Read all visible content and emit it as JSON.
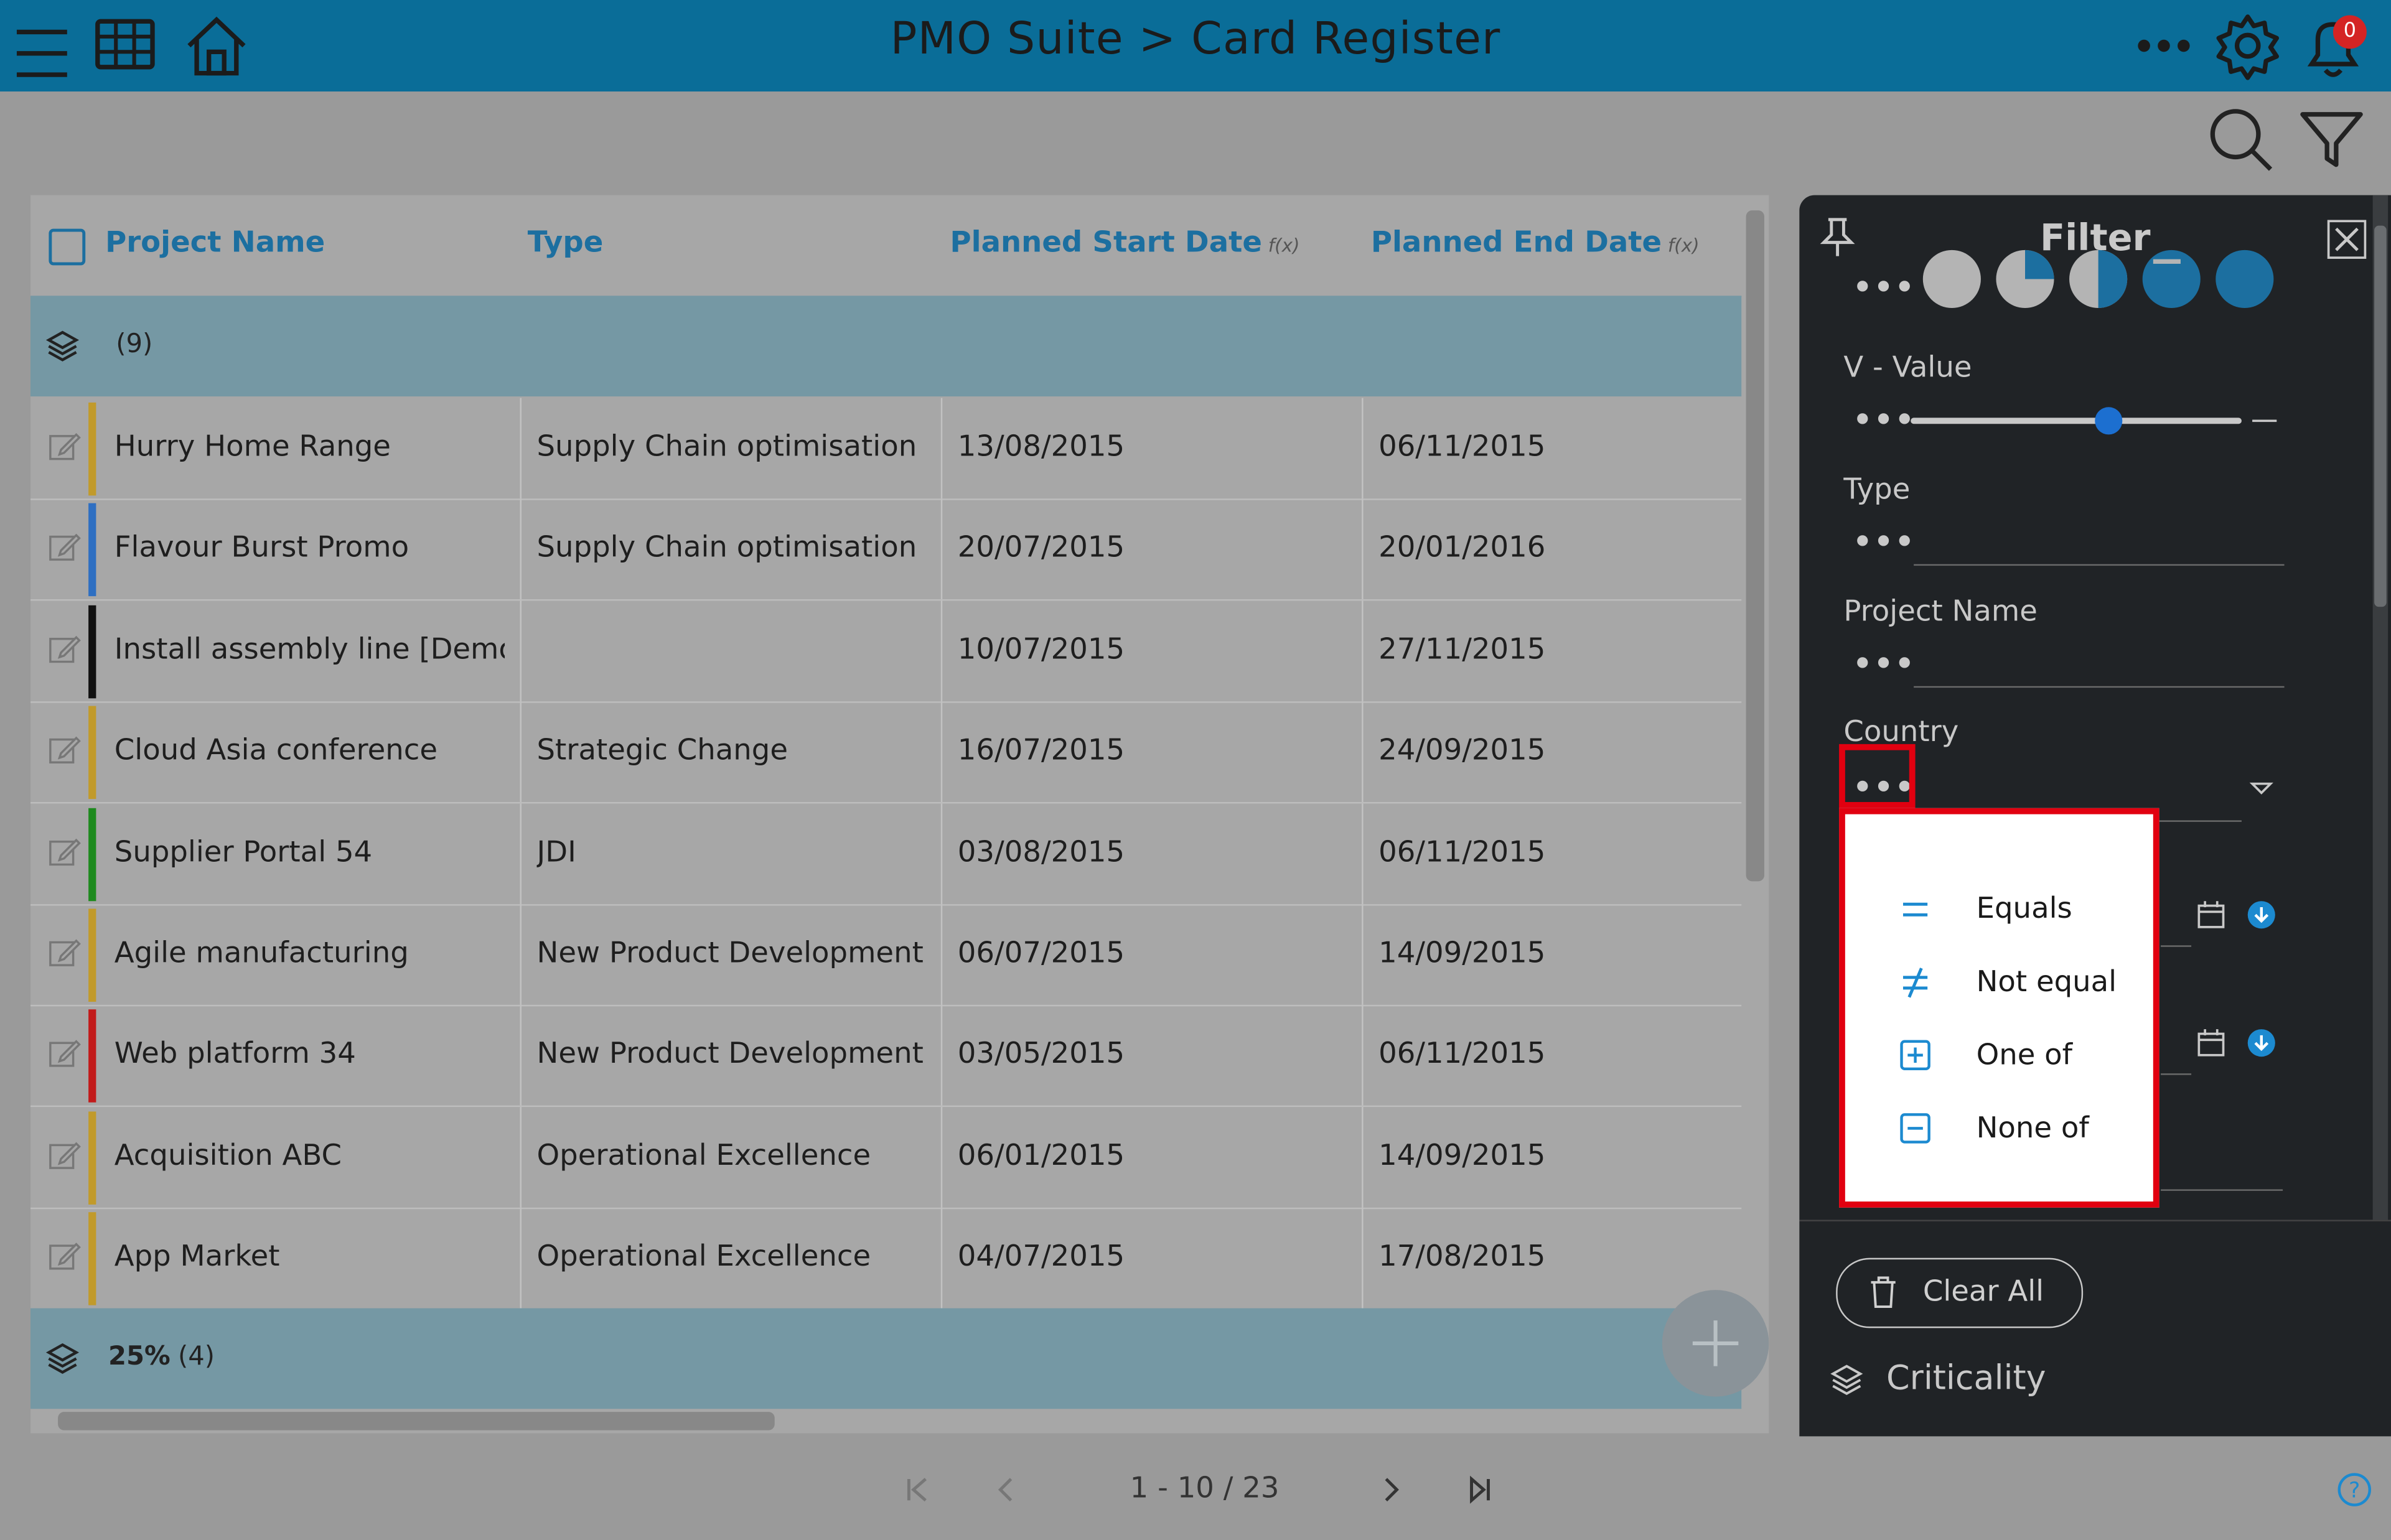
{
  "header": {
    "title": "PMO Suite > Card Register",
    "notification_count": "0"
  },
  "grid": {
    "columns": [
      {
        "label": "Project Name",
        "fx": ""
      },
      {
        "label": "Type",
        "fx": ""
      },
      {
        "label": "Planned Start Date",
        "fx": "f(x)"
      },
      {
        "label": "Planned End Date",
        "fx": "f(x)"
      }
    ],
    "group1": {
      "label": "",
      "count": "(9)"
    },
    "rows": [
      {
        "name": "Hurry Home Range",
        "type": "Supply Chain optimisation",
        "start": "13/08/2015",
        "end": "06/11/2015",
        "color": "#c19a2b"
      },
      {
        "name": "Flavour Burst Promo",
        "type": "Supply Chain optimisation",
        "start": "20/07/2015",
        "end": "20/01/2016",
        "color": "#2e6fc2"
      },
      {
        "name": "Install assembly line [Demo]",
        "type": "",
        "start": "10/07/2015",
        "end": "27/11/2015",
        "color": "#111111"
      },
      {
        "name": "Cloud Asia conference",
        "type": "Strategic Change",
        "start": "16/07/2015",
        "end": "24/09/2015",
        "color": "#c19a2b"
      },
      {
        "name": "Supplier Portal 54",
        "type": "JDI",
        "start": "03/08/2015",
        "end": "06/11/2015",
        "color": "#1e8a1e"
      },
      {
        "name": "Agile manufacturing",
        "type": "New Product Development",
        "start": "06/07/2015",
        "end": "14/09/2015",
        "color": "#c19a2b"
      },
      {
        "name": "Web platform 34",
        "type": "New Product Development",
        "start": "03/05/2015",
        "end": "06/11/2015",
        "color": "#c21a1a"
      },
      {
        "name": "Acquisition ABC",
        "type": "Operational Excellence",
        "start": "06/01/2015",
        "end": "14/09/2015",
        "color": "#c19a2b"
      },
      {
        "name": "App Market",
        "type": "Operational Excellence",
        "start": "04/07/2015",
        "end": "17/08/2015",
        "color": "#c19a2b"
      }
    ],
    "group2": {
      "label": "25%",
      "count": "(4)"
    }
  },
  "pagination": {
    "range": "1 - 10 / 23"
  },
  "filter": {
    "title": "Filter",
    "fields": {
      "v_value": "V - Value",
      "type": "Type",
      "project_name": "Project Name",
      "country": "Country"
    },
    "dots": "•••",
    "clear_all": "Clear All",
    "criticality": "Criticality",
    "v_value_slider": 0.6
  },
  "dropdown": {
    "items": [
      {
        "label": "Equals",
        "icon": "equals-icon"
      },
      {
        "label": "Not equal",
        "icon": "not-equal-icon"
      },
      {
        "label": "One of",
        "icon": "plus-box-icon"
      },
      {
        "label": "None of",
        "icon": "minus-box-icon"
      }
    ]
  },
  "colors": {
    "accent": "#0a6d98",
    "link": "#1c6fa0",
    "highlight": "#e10010"
  }
}
